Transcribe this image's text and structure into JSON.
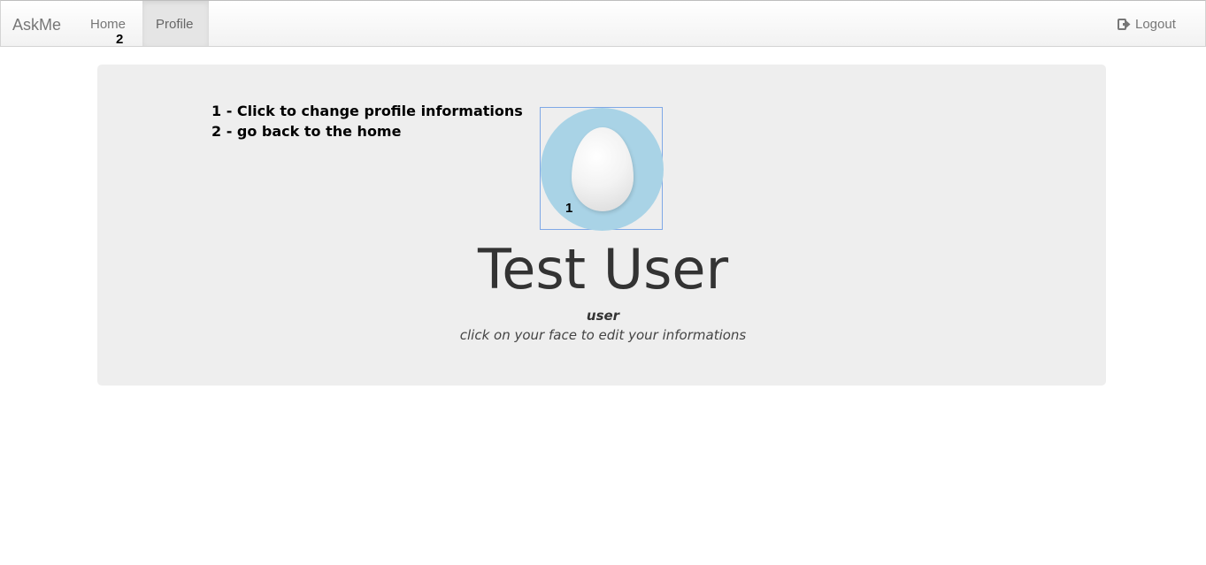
{
  "navbar": {
    "brand": "AskMe",
    "home_label": "Home",
    "profile_label": "Profile",
    "logout_label": "Logout",
    "logout_icon": "sign-out-icon"
  },
  "annotations": {
    "mark_1": "1",
    "mark_2": "2",
    "line_1": "1 - Click to change profile informations",
    "line_2": "2 - go back to the home"
  },
  "profile": {
    "avatar_icon": "egg-avatar-icon",
    "name": "Test User",
    "role": "user",
    "hint": "click on your face to edit your informations"
  }
}
